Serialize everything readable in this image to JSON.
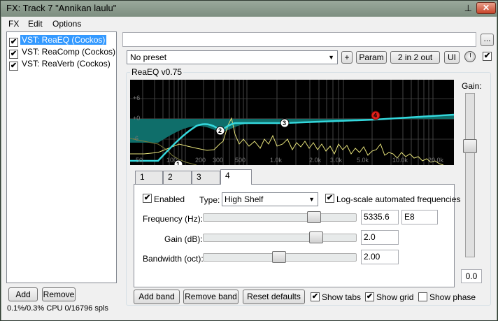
{
  "window": {
    "title": "FX: Track 7 \"Annikan laulu\""
  },
  "menu": [
    "FX",
    "Edit",
    "Options"
  ],
  "fx_chain": [
    {
      "label": "VST: ReaEQ (Cockos)",
      "checked": true,
      "selected": true
    },
    {
      "label": "VST: ReaComp (Cockos)",
      "checked": true,
      "selected": false
    },
    {
      "label": "VST: ReaVerb (Cockos)",
      "checked": true,
      "selected": false
    }
  ],
  "chain_buttons": {
    "add": "Add",
    "remove": "Remove"
  },
  "status": {
    "cpu": "0.1%/0.3% CPU 0/16796 spls"
  },
  "plugin_header": {
    "path_button": "...",
    "preset": "No preset",
    "plus_button": "+",
    "param_button": "Param",
    "io_button": "2 in 2 out",
    "ui_button": "UI"
  },
  "plugin": {
    "name": "ReaEQ v0.75"
  },
  "graph": {
    "db_labels": [
      "+6",
      "+0",
      "-6"
    ],
    "freq_labels": [
      "50",
      "100",
      "200",
      "300",
      "500",
      "1.0k",
      "2.0k",
      "3.0k",
      "5.0k",
      "10.0k",
      "20.0k"
    ],
    "band_markers": [
      "1",
      "2",
      "3",
      "4"
    ],
    "colors": {
      "fill": "#0f6e6a",
      "curve": "#34d7dc",
      "spectrum": "#e6e27a",
      "selected_band": "#e0201a"
    }
  },
  "gain": {
    "label": "Gain:",
    "value": "0.0"
  },
  "tabs": [
    "1",
    "2",
    "3",
    "4"
  ],
  "band": {
    "enabled_label": "Enabled",
    "enabled": true,
    "type_label": "Type:",
    "type": "High Shelf",
    "logscale_label": "Log-scale automated frequencies",
    "logscale": true,
    "frequency": {
      "label": "Frequency (Hz):",
      "value": "5335.6",
      "note": "E8"
    },
    "gain": {
      "label": "Gain (dB):",
      "value": "2.0"
    },
    "bandwidth": {
      "label": "Bandwidth (oct):",
      "value": "2.00"
    }
  },
  "bottom_buttons": {
    "add_band": "Add band",
    "remove_band": "Remove band",
    "reset": "Reset defaults"
  },
  "options": {
    "show_tabs": {
      "label": "Show tabs",
      "checked": true
    },
    "show_grid": {
      "label": "Show grid",
      "checked": true
    },
    "show_phase": {
      "label": "Show phase",
      "checked": false
    }
  }
}
